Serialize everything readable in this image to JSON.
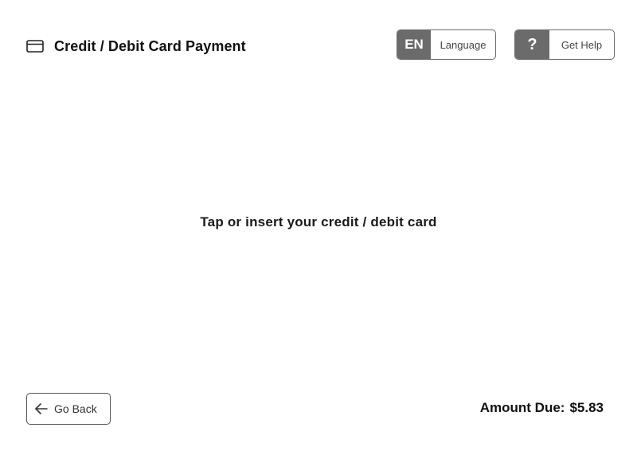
{
  "header": {
    "title": "Credit / Debit Card Payment",
    "title_icon": "credit-card-icon",
    "language_button": {
      "code": "EN",
      "label": "Language"
    },
    "help_button": {
      "symbol": "?",
      "label": "Get Help"
    }
  },
  "main": {
    "instruction": "Tap or insert your credit / debit card"
  },
  "footer": {
    "back_button": {
      "label": "Go Back",
      "icon": "arrow-left-icon"
    },
    "amount_due": {
      "label": "Amount Due:",
      "value": "$5.83"
    }
  },
  "colors": {
    "badge_background": "#6b6b6b",
    "border": "#6a6a6a",
    "text": "#111111"
  }
}
